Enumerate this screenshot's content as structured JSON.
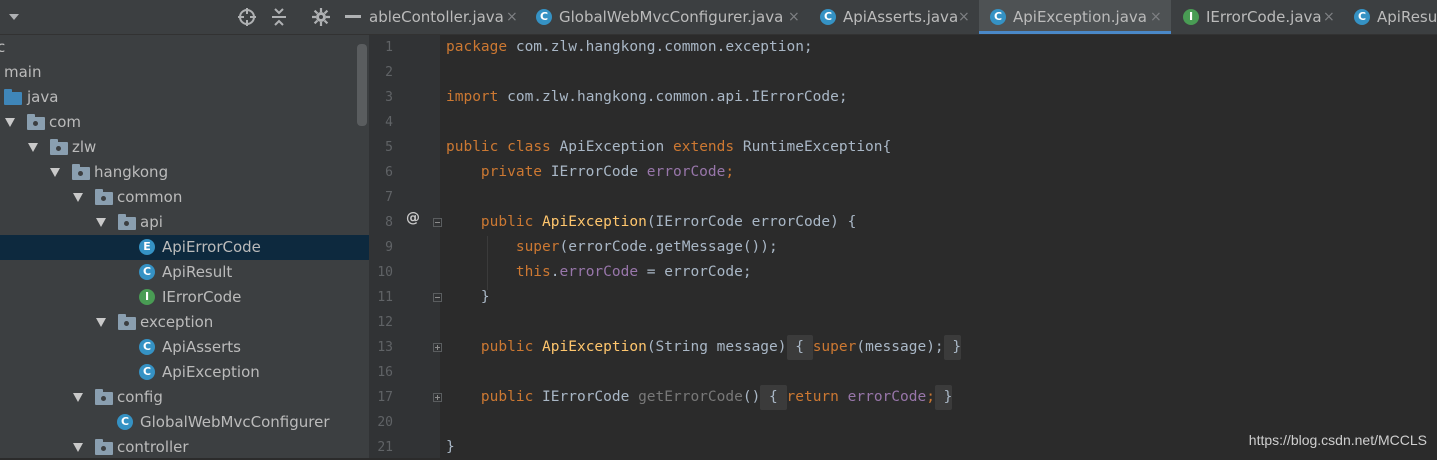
{
  "project": {
    "header_icons": [
      "dropdown-arrow-icon",
      "crosshair-icon",
      "collapse-icon",
      "gear-icon",
      "minimize-icon"
    ],
    "tree": [
      {
        "label": "c",
        "icon": "none"
      },
      {
        "label": "main",
        "icon": "none"
      },
      {
        "label": "java",
        "icon": "source-folder"
      },
      {
        "label": "com",
        "icon": "package"
      },
      {
        "label": "zlw",
        "icon": "package"
      },
      {
        "label": "hangkong",
        "icon": "package"
      },
      {
        "label": "common",
        "icon": "package"
      },
      {
        "label": "api",
        "icon": "package"
      },
      {
        "label": "ApiErrorCode",
        "icon": "enum",
        "selected": true
      },
      {
        "label": "ApiResult",
        "icon": "class"
      },
      {
        "label": "IErrorCode",
        "icon": "interface"
      },
      {
        "label": "exception",
        "icon": "package"
      },
      {
        "label": "ApiAsserts",
        "icon": "class"
      },
      {
        "label": "ApiException",
        "icon": "class"
      },
      {
        "label": "config",
        "icon": "package"
      },
      {
        "label": "GlobalWebMvcConfigurer",
        "icon": "class"
      },
      {
        "label": "controller",
        "icon": "package"
      }
    ]
  },
  "tabs": [
    {
      "label": "ableContoller.java",
      "icon": "none",
      "active": false
    },
    {
      "label": "GlobalWebMvcConfigurer.java",
      "icon": "C",
      "active": false
    },
    {
      "label": "ApiAsserts.java",
      "icon": "C",
      "active": false
    },
    {
      "label": "ApiException.java",
      "icon": "C",
      "active": true
    },
    {
      "label": "IErrorCode.java",
      "icon": "I",
      "active": false
    },
    {
      "label": "ApiResu",
      "icon": "C",
      "active": false
    }
  ],
  "tab_close_glyph": "×",
  "editor": {
    "line_numbers": [
      "1",
      "2",
      "3",
      "4",
      "5",
      "6",
      "7",
      "8",
      "9",
      "10",
      "11",
      "12",
      "13",
      "16",
      "17",
      "20",
      "21"
    ],
    "gutter_marker": "@",
    "code": {
      "l1": {
        "kw": "package",
        "rest": " com.zlw.hangkong.common.exception;"
      },
      "l3": {
        "kw": "import",
        "rest": " com.zlw.hangkong.common.api.IErrorCode;"
      },
      "l5": {
        "kw1": "public",
        "kw2": "class",
        "name": " ApiException ",
        "kw3": "extends",
        "rest": " RuntimeException{"
      },
      "l6": {
        "kw": "private",
        "type": " IErrorCode ",
        "field": "errorCode",
        "end": ";"
      },
      "l8": {
        "kw": "public",
        "method": "ApiException",
        "rest": "(IErrorCode errorCode) {"
      },
      "l9": {
        "kw": "super",
        "rest": "(errorCode.getMessage());"
      },
      "l10": {
        "kw": "this",
        "dot": ".",
        "field": "errorCode",
        "rest": " = errorCode;"
      },
      "l11": {
        "text": "}"
      },
      "l13": {
        "kw": "public",
        "method": "ApiException",
        "params": "(String message)",
        "open": " { ",
        "kw2": "super",
        "rest": "(message);",
        "close": " }"
      },
      "l17": {
        "kw": "public",
        "type": " IErrorCode ",
        "getter": "getErrorCode",
        "paren": "()",
        "open": " { ",
        "kw2": "return",
        "field": " errorCode",
        "semi": ";",
        "close": " }"
      },
      "l21": {
        "text": "}"
      }
    }
  },
  "watermark": "https://blog.csdn.net/MCCLS",
  "colors": {
    "keyword": "#cc7832",
    "field": "#9876aa",
    "method": "#ffc66d",
    "text": "#a9b7c6",
    "selection": "#0d293e",
    "tab_active_underline": "#4a88c7"
  }
}
